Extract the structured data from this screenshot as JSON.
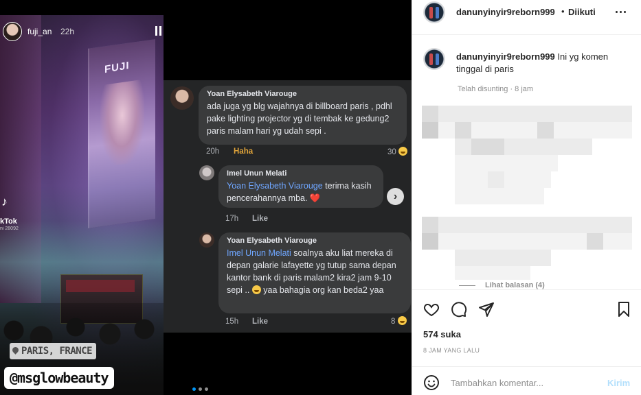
{
  "story": {
    "username": "fuji_an",
    "time": "22h",
    "billboard_text": "FUJI",
    "tiktok_icon": "♪",
    "tiktok_label": "kTok",
    "tiktok_id": "ni 28092",
    "location": "PARIS, FRANCE",
    "mention": "@msglowbeauty"
  },
  "fb_comments": {
    "c1": {
      "name": "Yoan Elysabeth Viarouge",
      "text": "ada juga yg blg wajahnya di billboard paris , pdhl pake lighting projector yg di tembak ke gedung2 paris malam hari yg udah sepi .",
      "time": "20h",
      "reaction": "Haha",
      "count": "30"
    },
    "c2": {
      "name": "Imel Unun Melati",
      "mention": "Yoan Elysabeth Viarouge",
      "text": " terima kasih pencerahannya mba. ",
      "heart": "❤️",
      "time": "17h",
      "action": "Like"
    },
    "c3": {
      "name": "Yoan Elysabeth Viarouge",
      "mention": "Imel Unun Melati",
      "text": " soalnya aku liat mereka di depan galarie lafayette yg tutup sama depan kantor bank di paris malam2 kira2 jam 9-10 sepi .. ",
      "text2": " yaa bahagia org kan beda2 yaa",
      "time": "15h",
      "action": "Like",
      "count": "8"
    }
  },
  "post": {
    "username": "danunyinyir9reborn999",
    "separator": "•",
    "follow_status": "Diikuti",
    "caption_user": "danunyinyir9reborn999",
    "caption_text": "Ini yg komen tinggal di paris",
    "caption_meta": "Telah disunting · 8 jam",
    "replies_toggle": "Lihat balasan (4)",
    "likes": "574 suka",
    "age": "8 JAM YANG LALU",
    "comment_placeholder": "Tambahkan komentar...",
    "post_label": "Kirim"
  },
  "colors": {
    "accent": "#0095f6",
    "post_disabled": "#b2dffc",
    "fb_mention": "#6fa6ff",
    "fb_bg": "#242526"
  },
  "carousel": {
    "total": 3,
    "active": 1
  }
}
